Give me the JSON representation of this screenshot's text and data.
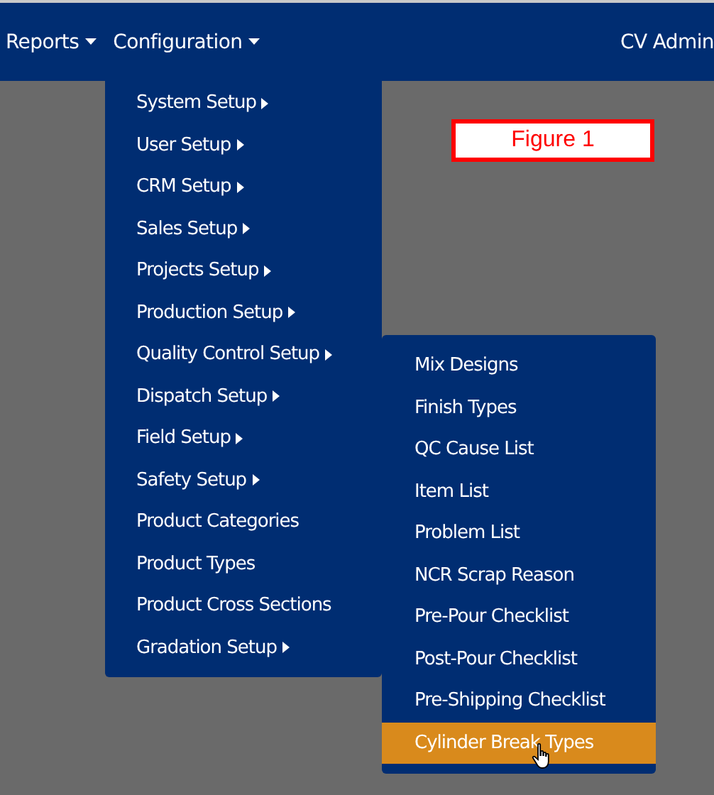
{
  "navbar": {
    "items": [
      {
        "label": "Reports",
        "has_caret": true
      },
      {
        "label": "Configuration",
        "has_caret": true
      }
    ],
    "user": "CV Admin"
  },
  "figure_label": "Figure 1",
  "menu": [
    {
      "label": "System Setup",
      "has_submenu": true,
      "selected": false
    },
    {
      "label": "User Setup",
      "has_submenu": true,
      "selected": false
    },
    {
      "label": "CRM Setup",
      "has_submenu": true,
      "selected": false
    },
    {
      "label": "Sales Setup",
      "has_submenu": true,
      "selected": false
    },
    {
      "label": "Projects Setup",
      "has_submenu": true,
      "selected": false
    },
    {
      "label": "Production Setup",
      "has_submenu": true,
      "selected": false
    },
    {
      "label": "Quality Control Setup",
      "has_submenu": true,
      "selected": false
    },
    {
      "label": "Dispatch Setup",
      "has_submenu": true,
      "selected": false
    },
    {
      "label": "Field Setup",
      "has_submenu": true,
      "selected": false
    },
    {
      "label": "Safety Setup",
      "has_submenu": true,
      "selected": false
    },
    {
      "label": "Product Categories",
      "has_submenu": false,
      "selected": false
    },
    {
      "label": "Product Types",
      "has_submenu": false,
      "selected": false
    },
    {
      "label": "Product Cross Sections",
      "has_submenu": false,
      "selected": false
    },
    {
      "label": "Gradation Setup",
      "has_submenu": true,
      "selected": false
    }
  ],
  "submenu": [
    {
      "label": "Mix Designs",
      "selected": false
    },
    {
      "label": "Finish Types",
      "selected": false
    },
    {
      "label": "QC Cause List",
      "selected": false
    },
    {
      "label": "Item List",
      "selected": false
    },
    {
      "label": "Problem List",
      "selected": false
    },
    {
      "label": "NCR Scrap Reason",
      "selected": false
    },
    {
      "label": "Pre-Pour Checklist",
      "selected": false
    },
    {
      "label": "Post-Pour Checklist",
      "selected": false
    },
    {
      "label": "Pre-Shipping Checklist",
      "selected": false
    },
    {
      "label": "Cylinder Break Types",
      "selected": true
    }
  ]
}
